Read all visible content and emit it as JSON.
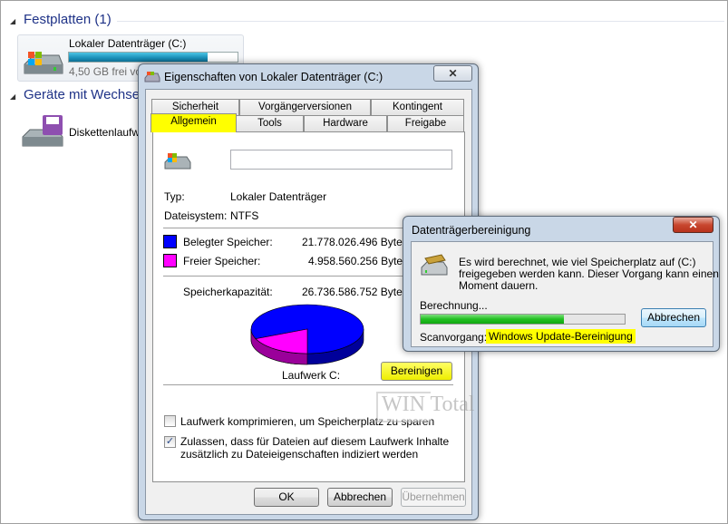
{
  "explorer": {
    "group_hdd": "Festplatten (1)",
    "drive_name": "Lokaler Datenträger (C:)",
    "drive_free": "4,50 GB frei vo",
    "drive_fill_fraction": 0.82,
    "group_removable": "Geräte mit Wechse",
    "floppy_name": "Diskettenlaufw"
  },
  "properties": {
    "title": "Eigenschaften von Lokaler Datenträger (C:)",
    "close": "✕",
    "tabs_row1": [
      "Sicherheit",
      "Vorgängerversionen",
      "Kontingent"
    ],
    "tabs_row2": [
      "Allgemein",
      "Tools",
      "Hardware",
      "Freigabe"
    ],
    "name_value": "",
    "type_label": "Typ:",
    "type_value": "Lokaler Datenträger",
    "fs_label": "Dateisystem:",
    "fs_value": "NTFS",
    "used_label": "Belegter Speicher:",
    "used_value": "21.778.026.496 Bytes",
    "free_label": "Freier Speicher:",
    "free_value": "4.958.560.256 Bytes",
    "cap_label": "Speicherkapazität:",
    "cap_value": "26.736.586.752 Bytes",
    "used_color": "#0000ff",
    "free_color": "#ff00ff",
    "used_fraction": 0.8145,
    "drive_label": "Laufwerk C:",
    "cleanup_button": "Bereinigen",
    "compress_label": "Laufwerk komprimieren, um Speicherplatz zu sparen",
    "compress_checked": false,
    "index_label_1": "Zulassen, dass für Dateien auf diesem Laufwerk Inhalte",
    "index_label_2": "zusätzlich zu Dateieigenschaften indiziert werden",
    "index_checked": true,
    "ok": "OK",
    "cancel": "Abbrechen",
    "apply": "Übernehmen"
  },
  "cleanup": {
    "title": "Datenträgerbereinigung",
    "close": "✕",
    "message_1": "Es wird berechnet, wie viel Speicherplatz auf  (C:)",
    "message_2": "freigegeben werden kann. Dieser Vorgang kann einen",
    "message_3": "Moment dauern.",
    "status": "Berechnung...",
    "progress_fraction": 0.7,
    "cancel": "Abbrechen",
    "scan_label": "Scanvorgang:",
    "scan_value": "Windows Update-Bereinigung"
  },
  "watermark": "WIN Total"
}
